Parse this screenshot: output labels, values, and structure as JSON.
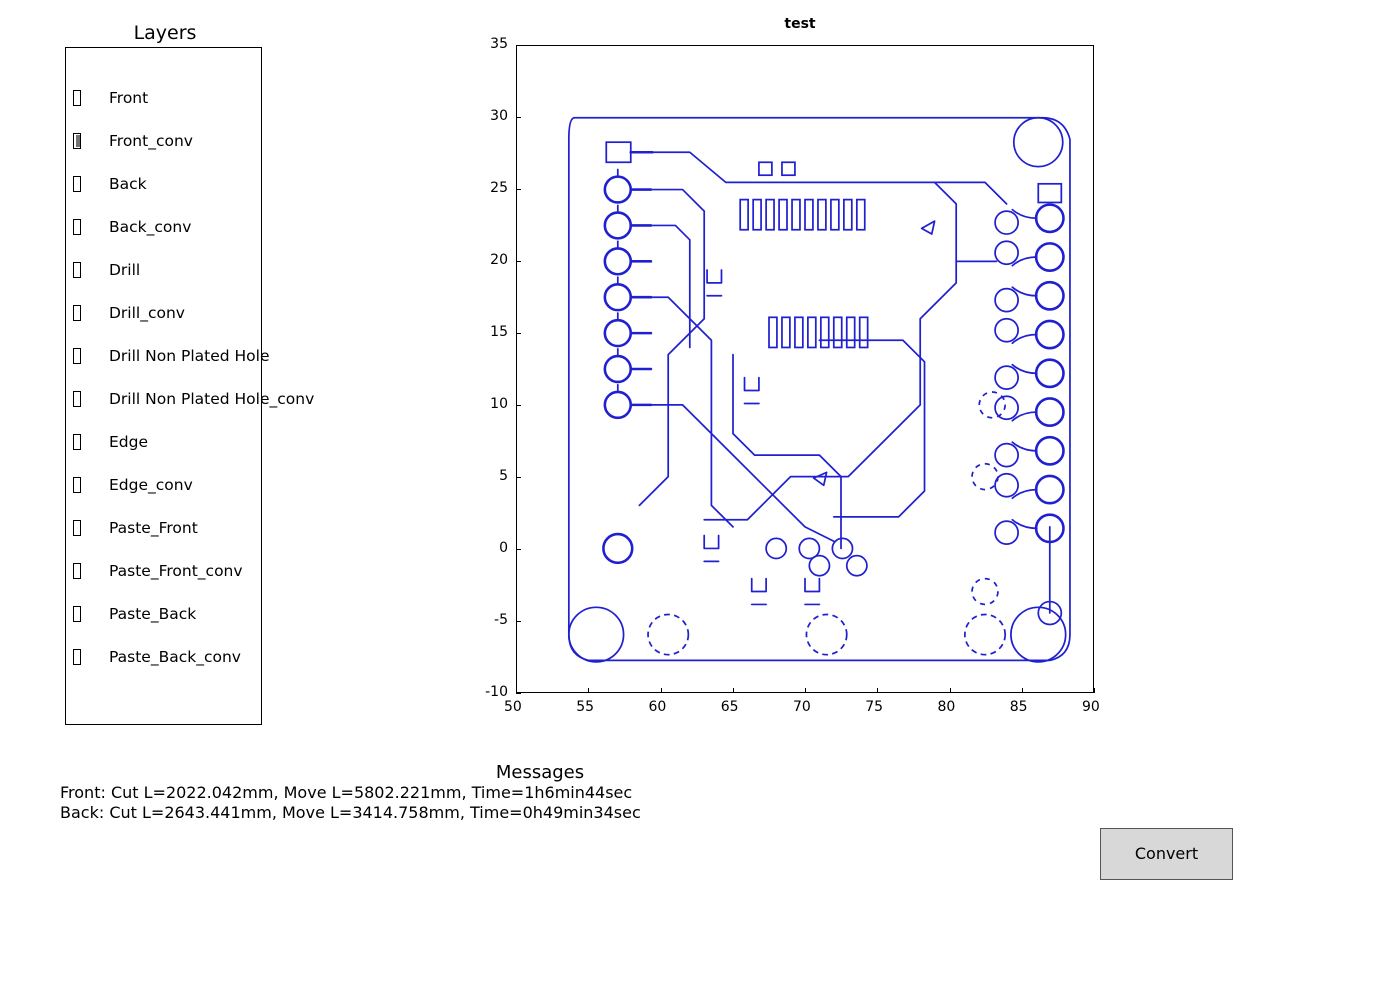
{
  "layers_panel": {
    "title": "Layers",
    "items": [
      {
        "label": "Front",
        "checked": false
      },
      {
        "label": "Front_conv",
        "checked": true
      },
      {
        "label": "Back",
        "checked": false
      },
      {
        "label": "Back_conv",
        "checked": false
      },
      {
        "label": "Drill",
        "checked": false
      },
      {
        "label": "Drill_conv",
        "checked": false
      },
      {
        "label": "Drill Non Plated Hole",
        "checked": false
      },
      {
        "label": "Drill Non Plated Hole_conv",
        "checked": false
      },
      {
        "label": "Edge",
        "checked": false
      },
      {
        "label": "Edge_conv",
        "checked": false
      },
      {
        "label": "Paste_Front",
        "checked": false
      },
      {
        "label": "Paste_Front_conv",
        "checked": false
      },
      {
        "label": "Paste_Back",
        "checked": false
      },
      {
        "label": "Paste_Back_conv",
        "checked": false
      }
    ]
  },
  "plot": {
    "title": "test",
    "xlim": [
      50,
      90
    ],
    "ylim": [
      -10,
      35
    ],
    "xticks": [
      50,
      55,
      60,
      65,
      70,
      75,
      80,
      85,
      90
    ],
    "yticks": [
      -10,
      -5,
      0,
      5,
      10,
      15,
      20,
      25,
      30,
      35
    ],
    "stroke_color": "#2020d0"
  },
  "messages": {
    "title": "Messages",
    "lines": [
      "Front: Cut L=2022.042mm, Move L=5802.221mm, Time=1h6min44sec",
      "Back: Cut L=2643.441mm, Move L=3414.758mm, Time=0h49min34sec"
    ]
  },
  "convert_button": {
    "label": "Convert"
  }
}
